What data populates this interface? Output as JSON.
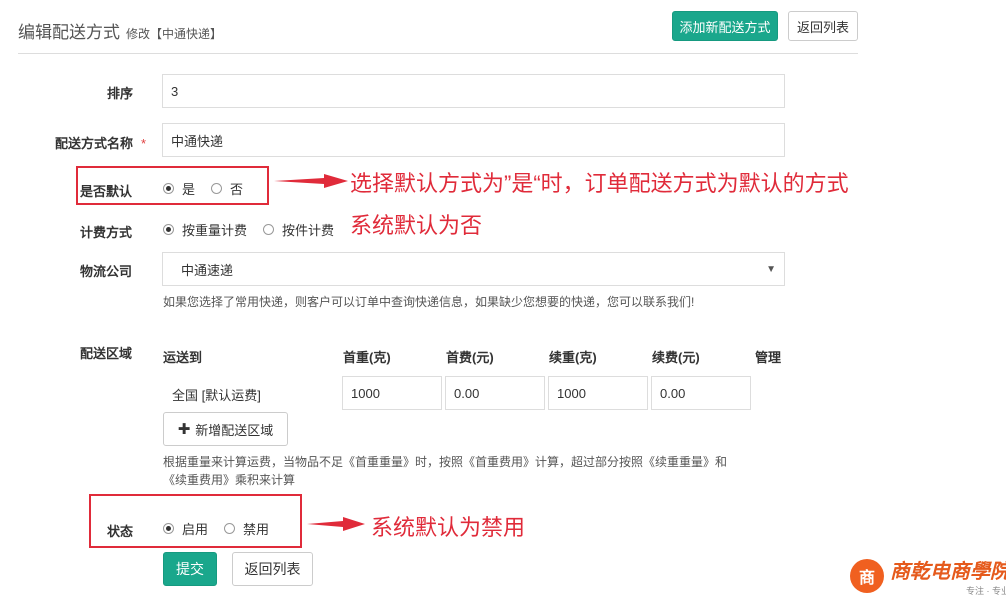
{
  "header": {
    "title": "编辑配送方式",
    "subtitle": "修改【中通快递】",
    "add_button": "添加新配送方式",
    "back_button": "返回列表"
  },
  "form": {
    "sort": {
      "label": "排序",
      "value": "3"
    },
    "name": {
      "label": "配送方式名称",
      "required_mark": "*",
      "value": "中通快递"
    },
    "default": {
      "label": "是否默认",
      "options": [
        "是",
        "否"
      ],
      "selected": "是"
    },
    "billing": {
      "label": "计费方式",
      "options": [
        "按重量计费",
        "按件计费"
      ],
      "selected": "按重量计费"
    },
    "logistics": {
      "label": "物流公司",
      "selected": "中通速递",
      "help": "如果您选择了常用快递，则客户可以订单中查询快递信息，如果缺少您想要的快递，您可以联系我们!"
    },
    "area": {
      "label": "配送区域",
      "columns": [
        "运送到",
        "首重(克)",
        "首费(元)",
        "续重(克)",
        "续费(元)",
        "管理"
      ],
      "row": {
        "region": "全国 [默认运费]",
        "first_weight": "1000",
        "first_fee": "0.00",
        "extra_weight": "1000",
        "extra_fee": "0.00"
      },
      "add_button": "新增配送区域",
      "help_line1": "根据重量来计算运费，当物品不足《首重重量》时，按照《首重费用》计算，超过部分按照《续重重量》和",
      "help_line2": "《续重费用》乘积来计算"
    },
    "status": {
      "label": "状态",
      "options": [
        "启用",
        "禁用"
      ],
      "selected": "启用"
    },
    "submit_button": "提交",
    "back_button": "返回列表"
  },
  "annotations": {
    "default_note_line1": "选择默认方式为”是“时，订单配送方式为默认的方式",
    "default_note_line2": "系统默认为否",
    "status_note": "系统默认为禁用"
  },
  "colors": {
    "primary": "#1aa78c",
    "annotation_red": "#e02b3a",
    "logo_orange": "#e55a1c"
  },
  "logo": {
    "mark": "商",
    "main": "商乾电商學院",
    "sub": "专注 · 专业"
  }
}
